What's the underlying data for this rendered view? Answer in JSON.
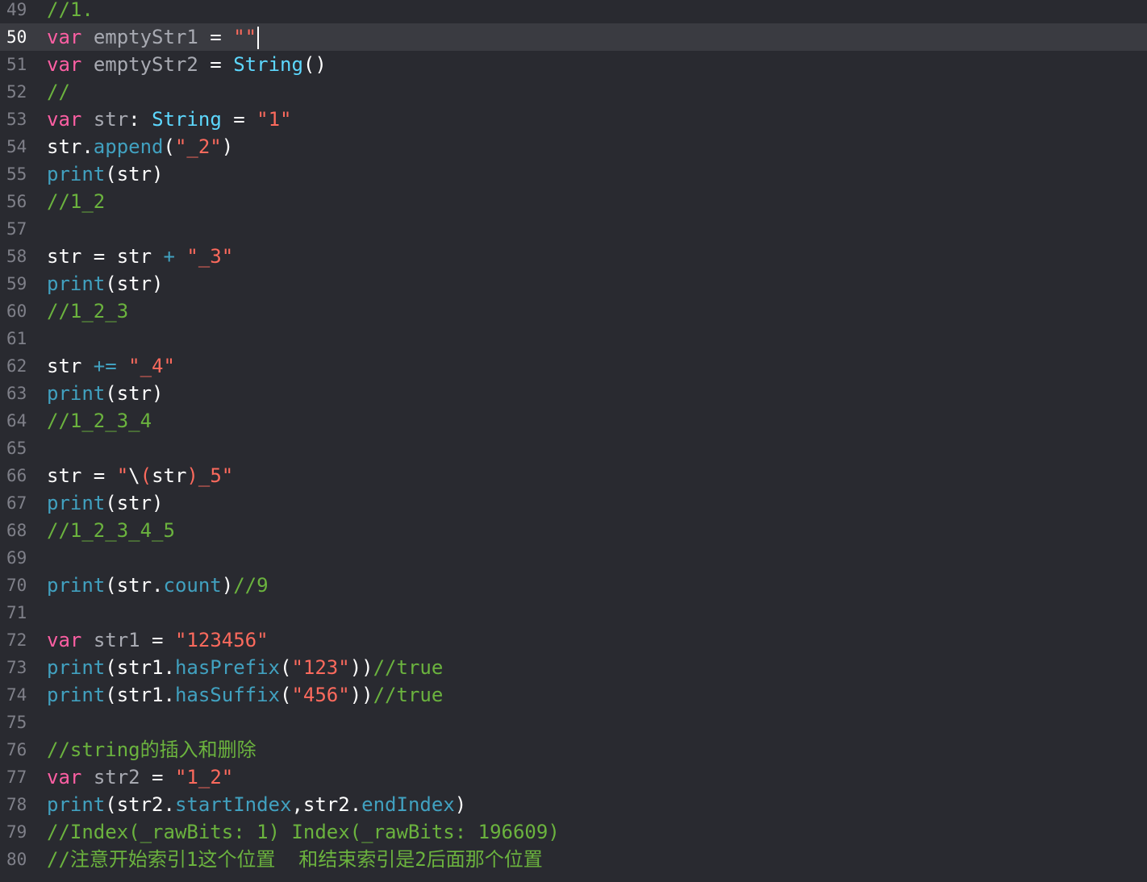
{
  "editor": {
    "current_line": 50,
    "lines": [
      {
        "n": "49",
        "tokens": [
          {
            "t": "comment",
            "v": "//1."
          }
        ]
      },
      {
        "n": "50",
        "tokens": [
          {
            "t": "keyword",
            "v": "var"
          },
          {
            "t": "plain",
            "v": " "
          },
          {
            "t": "ident",
            "v": "emptyStr1"
          },
          {
            "t": "plain",
            "v": " = "
          },
          {
            "t": "string",
            "v": "\"\""
          }
        ],
        "cursor": true
      },
      {
        "n": "51",
        "tokens": [
          {
            "t": "keyword",
            "v": "var"
          },
          {
            "t": "plain",
            "v": " "
          },
          {
            "t": "ident",
            "v": "emptyStr2"
          },
          {
            "t": "plain",
            "v": " = "
          },
          {
            "t": "type",
            "v": "String"
          },
          {
            "t": "plain",
            "v": "()"
          }
        ]
      },
      {
        "n": "52",
        "tokens": [
          {
            "t": "comment",
            "v": "//"
          }
        ]
      },
      {
        "n": "53",
        "tokens": [
          {
            "t": "keyword",
            "v": "var"
          },
          {
            "t": "plain",
            "v": " "
          },
          {
            "t": "ident",
            "v": "str"
          },
          {
            "t": "plain",
            "v": ": "
          },
          {
            "t": "type",
            "v": "String"
          },
          {
            "t": "plain",
            "v": " = "
          },
          {
            "t": "string",
            "v": "\"1\""
          }
        ]
      },
      {
        "n": "54",
        "tokens": [
          {
            "t": "plain",
            "v": "str."
          },
          {
            "t": "func",
            "v": "append"
          },
          {
            "t": "plain",
            "v": "("
          },
          {
            "t": "string",
            "v": "\"_2\""
          },
          {
            "t": "plain",
            "v": ")"
          }
        ]
      },
      {
        "n": "55",
        "tokens": [
          {
            "t": "func",
            "v": "print"
          },
          {
            "t": "plain",
            "v": "(str)"
          }
        ]
      },
      {
        "n": "56",
        "tokens": [
          {
            "t": "comment",
            "v": "//1_2"
          }
        ]
      },
      {
        "n": "57",
        "tokens": []
      },
      {
        "n": "58",
        "tokens": [
          {
            "t": "plain",
            "v": "str = str "
          },
          {
            "t": "func",
            "v": "+"
          },
          {
            "t": "plain",
            "v": " "
          },
          {
            "t": "string",
            "v": "\"_3\""
          }
        ]
      },
      {
        "n": "59",
        "tokens": [
          {
            "t": "func",
            "v": "print"
          },
          {
            "t": "plain",
            "v": "(str)"
          }
        ]
      },
      {
        "n": "60",
        "tokens": [
          {
            "t": "comment",
            "v": "//1_2_3"
          }
        ]
      },
      {
        "n": "61",
        "tokens": []
      },
      {
        "n": "62",
        "tokens": [
          {
            "t": "plain",
            "v": "str "
          },
          {
            "t": "func",
            "v": "+="
          },
          {
            "t": "plain",
            "v": " "
          },
          {
            "t": "string",
            "v": "\"_4\""
          }
        ]
      },
      {
        "n": "63",
        "tokens": [
          {
            "t": "func",
            "v": "print"
          },
          {
            "t": "plain",
            "v": "(str)"
          }
        ]
      },
      {
        "n": "64",
        "tokens": [
          {
            "t": "comment",
            "v": "//1_2_3_4"
          }
        ]
      },
      {
        "n": "65",
        "tokens": []
      },
      {
        "n": "66",
        "tokens": [
          {
            "t": "plain",
            "v": "str = "
          },
          {
            "t": "string",
            "v": "\""
          },
          {
            "t": "plain",
            "v": "\\"
          },
          {
            "t": "string",
            "v": "("
          },
          {
            "t": "plain",
            "v": "str"
          },
          {
            "t": "string",
            "v": ")_5\""
          }
        ]
      },
      {
        "n": "67",
        "tokens": [
          {
            "t": "func",
            "v": "print"
          },
          {
            "t": "plain",
            "v": "(str)"
          }
        ]
      },
      {
        "n": "68",
        "tokens": [
          {
            "t": "comment",
            "v": "//1_2_3_4_5"
          }
        ]
      },
      {
        "n": "69",
        "tokens": []
      },
      {
        "n": "70",
        "tokens": [
          {
            "t": "func",
            "v": "print"
          },
          {
            "t": "plain",
            "v": "(str."
          },
          {
            "t": "func",
            "v": "count"
          },
          {
            "t": "plain",
            "v": ")"
          },
          {
            "t": "comment",
            "v": "//9"
          }
        ]
      },
      {
        "n": "71",
        "tokens": []
      },
      {
        "n": "72",
        "tokens": [
          {
            "t": "keyword",
            "v": "var"
          },
          {
            "t": "plain",
            "v": " "
          },
          {
            "t": "ident",
            "v": "str1"
          },
          {
            "t": "plain",
            "v": " = "
          },
          {
            "t": "string",
            "v": "\"123456\""
          }
        ]
      },
      {
        "n": "73",
        "tokens": [
          {
            "t": "func",
            "v": "print"
          },
          {
            "t": "plain",
            "v": "(str1."
          },
          {
            "t": "func",
            "v": "hasPrefix"
          },
          {
            "t": "plain",
            "v": "("
          },
          {
            "t": "string",
            "v": "\"123\""
          },
          {
            "t": "plain",
            "v": "))"
          },
          {
            "t": "comment",
            "v": "//true"
          }
        ]
      },
      {
        "n": "74",
        "tokens": [
          {
            "t": "func",
            "v": "print"
          },
          {
            "t": "plain",
            "v": "(str1."
          },
          {
            "t": "func",
            "v": "hasSuffix"
          },
          {
            "t": "plain",
            "v": "("
          },
          {
            "t": "string",
            "v": "\"456\""
          },
          {
            "t": "plain",
            "v": "))"
          },
          {
            "t": "comment",
            "v": "//true"
          }
        ]
      },
      {
        "n": "75",
        "tokens": []
      },
      {
        "n": "76",
        "tokens": [
          {
            "t": "comment",
            "v": "//string的插入和删除"
          }
        ]
      },
      {
        "n": "77",
        "tokens": [
          {
            "t": "keyword",
            "v": "var"
          },
          {
            "t": "plain",
            "v": " "
          },
          {
            "t": "ident",
            "v": "str2"
          },
          {
            "t": "plain",
            "v": " = "
          },
          {
            "t": "string",
            "v": "\"1_2\""
          }
        ]
      },
      {
        "n": "78",
        "tokens": [
          {
            "t": "func",
            "v": "print"
          },
          {
            "t": "plain",
            "v": "(str2."
          },
          {
            "t": "func",
            "v": "startIndex"
          },
          {
            "t": "plain",
            "v": ",str2."
          },
          {
            "t": "func",
            "v": "endIndex"
          },
          {
            "t": "plain",
            "v": ")"
          }
        ]
      },
      {
        "n": "79",
        "tokens": [
          {
            "t": "comment",
            "v": "//Index(_rawBits: 1) Index(_rawBits: 196609)"
          }
        ]
      },
      {
        "n": "80",
        "tokens": [
          {
            "t": "comment",
            "v": "//注意开始索引1这个位置  和结束索引是2后面那个位置"
          }
        ]
      }
    ]
  },
  "colors": {
    "background": "#292a30",
    "current_line_bg": "#3a3b41",
    "keyword": "#fc5fa3",
    "string": "#fc6a5d",
    "type": "#5dd8ff",
    "function": "#41a1c0",
    "comment": "#6bb33e",
    "line_number": "#7f8089"
  }
}
